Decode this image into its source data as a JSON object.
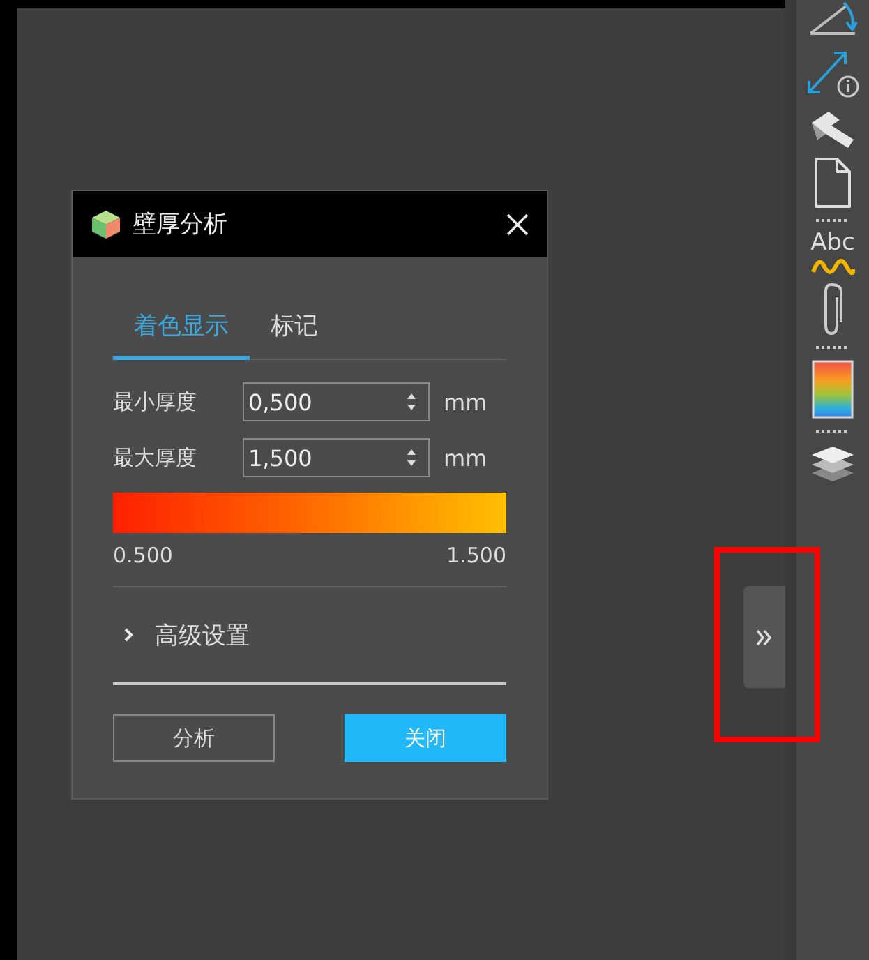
{
  "toolbar": {
    "items": [
      {
        "kind": "angle"
      },
      {
        "kind": "distance"
      },
      {
        "kind": "tool"
      },
      {
        "kind": "page"
      },
      {
        "kind": "separator"
      },
      {
        "kind": "text",
        "label": "Abc"
      },
      {
        "kind": "clip"
      },
      {
        "kind": "separator"
      },
      {
        "kind": "gradient"
      },
      {
        "kind": "separator"
      },
      {
        "kind": "layers"
      }
    ]
  },
  "collapse_tab": {
    "highlighted": true
  },
  "dialog": {
    "title": "壁厚分析",
    "tabs": [
      {
        "label": "着色显示",
        "selected": true
      },
      {
        "label": "标记",
        "selected": false
      }
    ],
    "fields": [
      {
        "label": "最小厚度",
        "value": "0,500",
        "unit": "mm"
      },
      {
        "label": "最大厚度",
        "value": "1,500",
        "unit": "mm"
      }
    ],
    "scale": {
      "min": "0.500",
      "max": "1.500"
    },
    "advanced": {
      "label": "高级设置",
      "expanded": false
    },
    "buttons": [
      {
        "label": "分析",
        "kind": "secondary"
      },
      {
        "label": "关闭",
        "kind": "primary"
      }
    ]
  }
}
